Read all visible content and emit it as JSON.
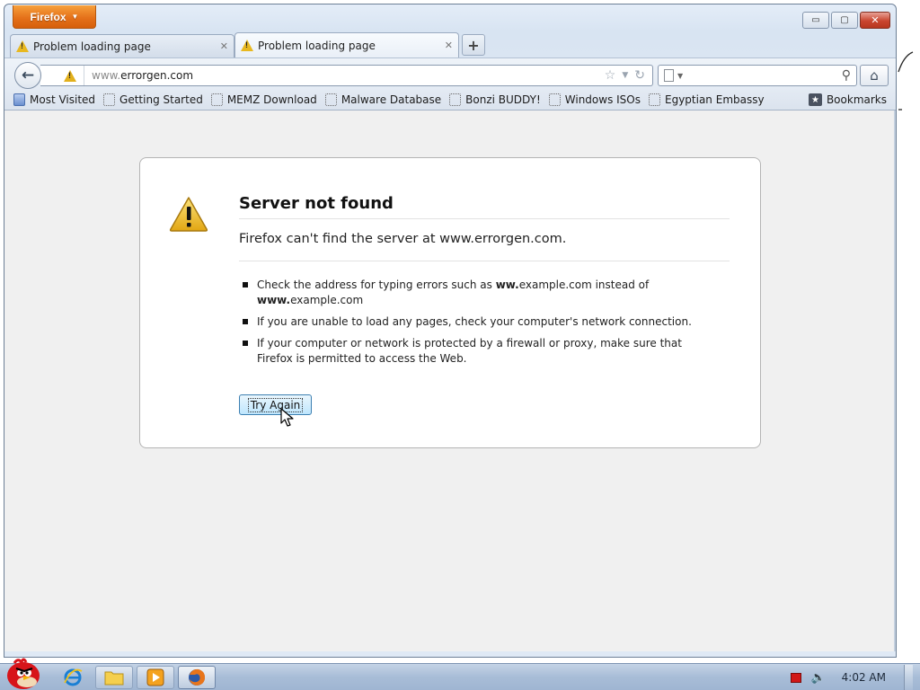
{
  "window": {
    "app_button_label": "Firefox",
    "controls": {
      "minimize": "▭",
      "maximize": "▢",
      "close": "✕"
    }
  },
  "tabs": [
    {
      "label": "Problem loading page",
      "icon": "warning-icon",
      "active": false
    },
    {
      "label": "Problem loading page",
      "icon": "warning-icon",
      "active": true
    }
  ],
  "new_tab_label": "+",
  "navbar": {
    "url_prefix": "www.",
    "url_host": "errorgen.com",
    "search_placeholder": ""
  },
  "bookmarks": {
    "items": [
      {
        "label": "Most Visited",
        "icon": "most-visited-icon"
      },
      {
        "label": "Getting Started",
        "icon": "bookmark-page-icon"
      },
      {
        "label": "MEMZ Download",
        "icon": "bookmark-page-icon"
      },
      {
        "label": "Malware Database",
        "icon": "bookmark-page-icon"
      },
      {
        "label": "Bonzi BUDDY!",
        "icon": "bookmark-page-icon"
      },
      {
        "label": "Windows ISOs",
        "icon": "bookmark-page-icon"
      },
      {
        "label": "Egyptian Embassy",
        "icon": "bookmark-page-icon"
      }
    ],
    "menu_label": "Bookmarks"
  },
  "error": {
    "title": "Server not found",
    "short_desc": "Firefox can't find the server at www.errorgen.com.",
    "tips": [
      {
        "pre": "Check the address for typing errors such as ",
        "b1": "ww.",
        "mid": "example.com instead of ",
        "b2": "www.",
        "post": "example.com"
      },
      {
        "text": "If you are unable to load any pages, check your computer's network connection."
      },
      {
        "text": "If your computer or network is protected by a firewall or proxy, make sure that Firefox is permitted to access the Web."
      }
    ],
    "button_label": "Try Again"
  },
  "taskbar": {
    "clock": "4:02 AM",
    "items": [
      "angry-bird-start-icon",
      "internet-explorer-icon",
      "folder-icon",
      "media-player-icon",
      "firefox-icon"
    ]
  },
  "colors": {
    "firefox_orange": "#e5711a",
    "warning_yellow": "#e8b820",
    "content_bg": "#f0f0f0"
  }
}
